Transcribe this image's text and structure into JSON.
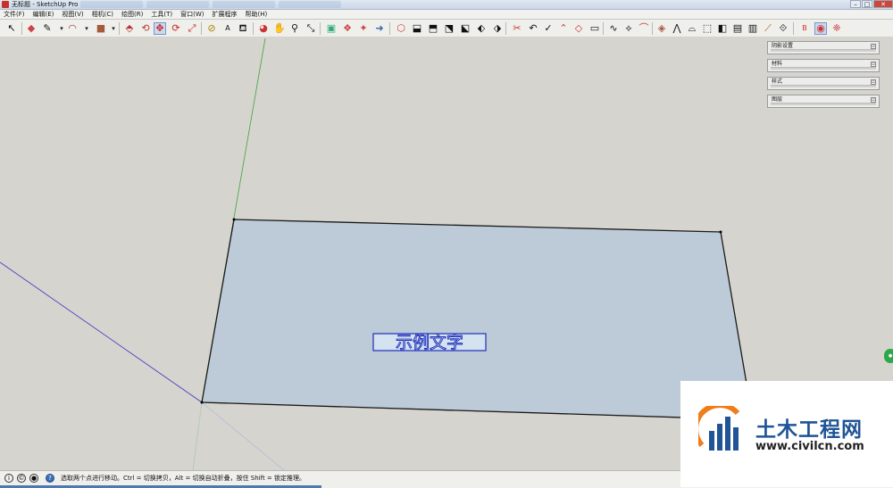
{
  "window": {
    "title": "无标题 - SketchUp Pro"
  },
  "menu": [
    "文件(F)",
    "编辑(E)",
    "视图(V)",
    "相机(C)",
    "绘图(R)",
    "工具(T)",
    "窗口(W)",
    "扩展程序",
    "帮助(H)"
  ],
  "toolbar": {
    "icons": [
      "select-tool",
      "eraser-tool",
      "pencil-tool",
      "arc-tool",
      "shape-tool",
      "push-pull-tool",
      "follow-me-tool",
      "move-tool",
      "rotate-tool",
      "scale-tool",
      "tape-measure-tool",
      "text-tool",
      "paint-bucket-tool",
      "orbit-tool",
      "zoom-tool",
      "zoom-extents-tool",
      "iso-view",
      "top-view",
      "front-view",
      "right-view",
      "back-view",
      "left-view",
      "bottom-view",
      "xray-style",
      "wireframe-style",
      "hidden-line-style",
      "shaded-style",
      "textured-style",
      "monochrome-style",
      "sandbox-tool",
      "section-plane-tool",
      "warehouse-tool",
      "extension-tool"
    ],
    "active": "move-tool"
  },
  "panels": [
    {
      "title": "阴影设置"
    },
    {
      "title": "材料"
    },
    {
      "title": "样式"
    },
    {
      "title": "图层"
    }
  ],
  "viewport": {
    "text_label": "示例文字",
    "face_color": "#bccbd7",
    "axis_colors": {
      "red": "#8b1a1a",
      "green": "#3fa33f",
      "blue": "#3b3bbf"
    }
  },
  "statusbar": {
    "message": "选取两个点进行移动。Ctrl = 切换拷贝，Alt = 切换自动折叠，按住 Shift = 锁定推理。"
  },
  "watermark": {
    "brand": "土木工程网",
    "url": "www.civilcn.com"
  }
}
